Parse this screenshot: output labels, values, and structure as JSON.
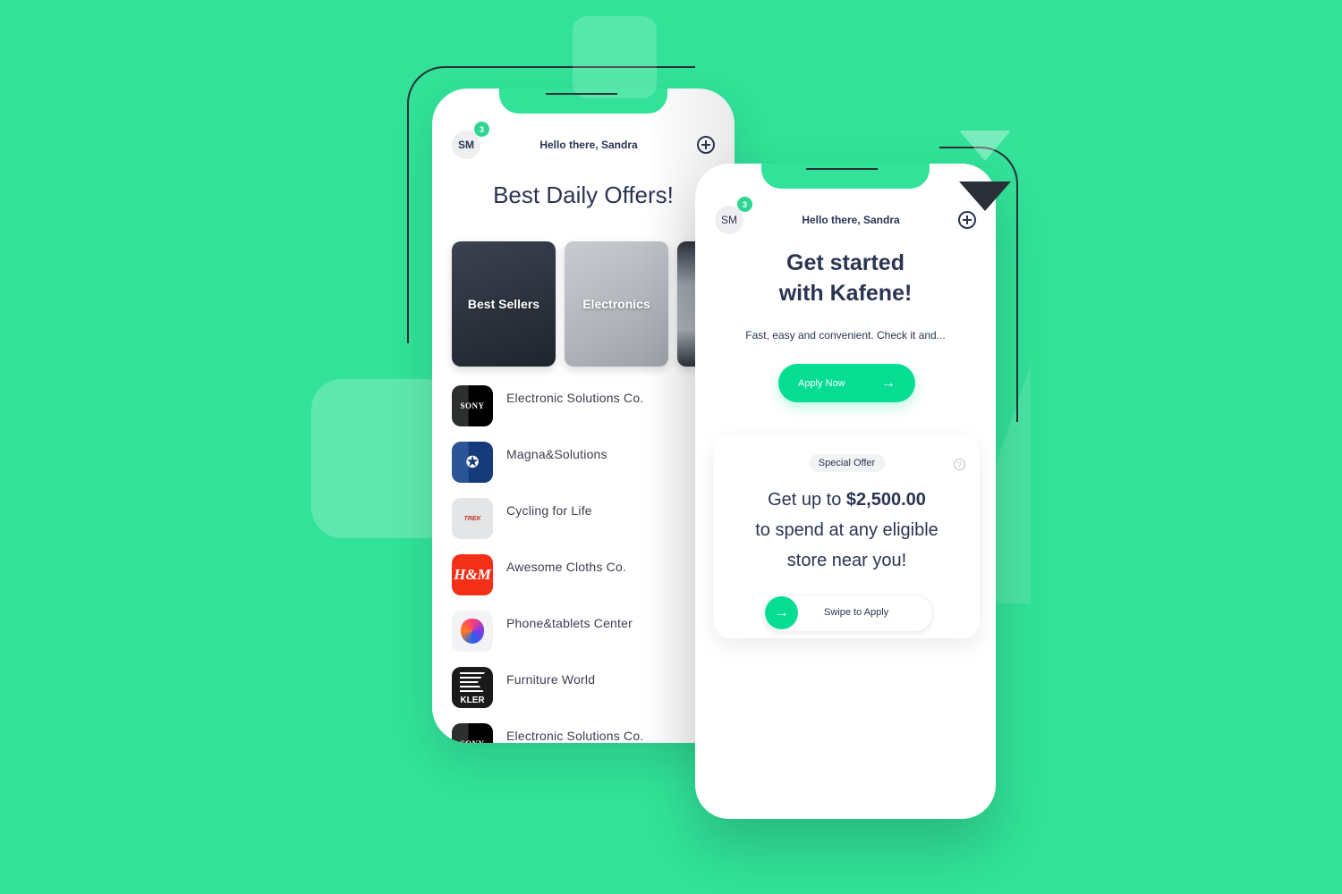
{
  "colors": {
    "background": "#31e298",
    "accent": "#05dd92",
    "text_primary": "#2b3452",
    "badge": "#2fd692"
  },
  "phone_left": {
    "header": {
      "avatar_initials": "SM",
      "notification_count": "3",
      "greeting": "Hello there, Sandra",
      "add_icon": "plus-circle-icon"
    },
    "title": "Best Daily Offers!",
    "categories": [
      {
        "label": "Best Sellers"
      },
      {
        "label": "Electronics"
      },
      {
        "label": ""
      }
    ],
    "stores": [
      {
        "name": "Electronic Solutions Co.",
        "logo": "SONY"
      },
      {
        "name": "Magna&Solutions",
        "logo": "Mercedes-Benz"
      },
      {
        "name": "Cycling for Life",
        "logo": "TREK"
      },
      {
        "name": "Awesome Cloths Co.",
        "logo": "H&M"
      },
      {
        "name": "Phone&tablets Center",
        "logo": "Apple"
      },
      {
        "name": "Furniture World",
        "logo": "KLER"
      },
      {
        "name": "Electronic Solutions Co.",
        "logo": "SONY"
      }
    ]
  },
  "phone_right": {
    "header": {
      "avatar_initials": "SM",
      "notification_count": "3",
      "greeting": "Hello there, Sandra",
      "add_icon": "plus-circle-icon"
    },
    "title_line1": "Get started",
    "title_line2": "with Kafene!",
    "subtitle": "Fast, easy and convenient. Check it and...",
    "apply_button": "Apply Now",
    "offer": {
      "badge": "Special Offer",
      "help_icon": "?",
      "text_prefix": "Get up to ",
      "amount": "$2,500.00",
      "text_line2": "to spend at any eligible",
      "text_line3": "store near you!",
      "swipe_label": "Swipe to Apply"
    }
  },
  "icons": {
    "arrow": "→",
    "mercedes_star": "✪"
  }
}
